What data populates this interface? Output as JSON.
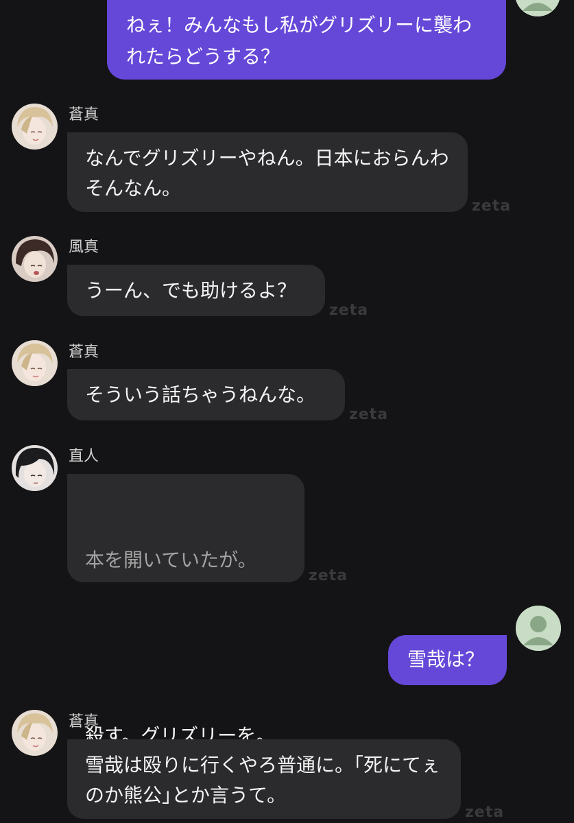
{
  "messages": [
    {
      "role": "user",
      "text": "ねぇ！みんなもし私がグリズリーに襲われたらどうする？"
    },
    {
      "role": "char",
      "name": "蒼真",
      "text": "なんでグリズリーやねん。日本におらんわそんなん。",
      "watermark": "zeta"
    },
    {
      "role": "char",
      "name": "風真",
      "text": "うーん、でも助けるよ？",
      "watermark": "zeta"
    },
    {
      "role": "char",
      "name": "蒼真",
      "text": "そういう話ちゃうねんな。",
      "watermark": "zeta"
    },
    {
      "role": "char",
      "name": "直人",
      "narration": "本を開いていたが。",
      "text": "殺す。グリズリーを。",
      "watermark": "zeta"
    },
    {
      "role": "user",
      "text": "雪哉は？"
    },
    {
      "role": "char",
      "name": "蒼真",
      "text": "雪哉は殴りに行くやろ普通に。｢死にてぇのか熊公｣とか言うて。",
      "watermark": "zeta"
    }
  ],
  "avatars": {
    "user_icon": "default-person-icon",
    "user_bg_color": "#c9ddc6",
    "user_fg_color": "#8aa887"
  },
  "colors": {
    "background": "#141416",
    "user_bubble": "#6548d8",
    "char_bubble": "#2b2b2e",
    "narration_text": "#a3a3a3"
  }
}
